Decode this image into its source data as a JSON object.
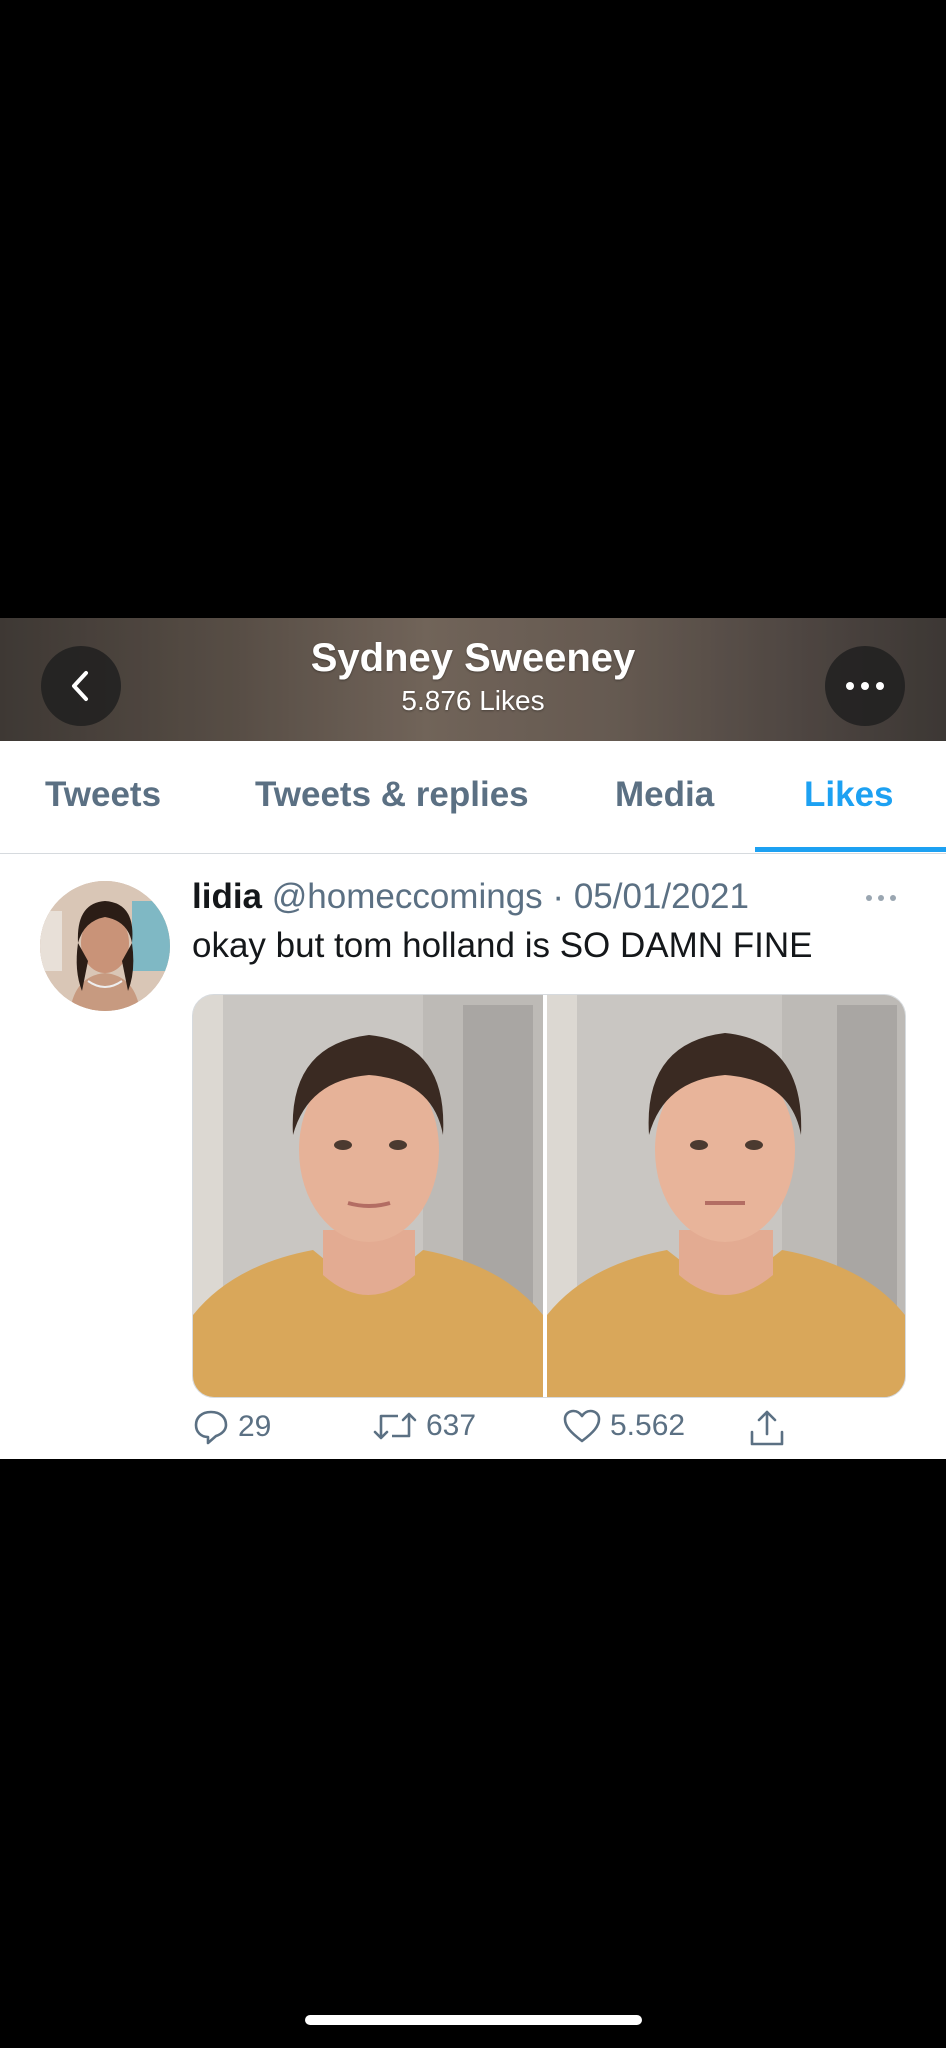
{
  "header": {
    "title": "Sydney Sweeney",
    "subtitle": "5.876 Likes",
    "back_icon": "chevron-left-icon",
    "more_icon": "more-horizontal-icon"
  },
  "tabs": [
    {
      "label": "Tweets",
      "active": false
    },
    {
      "label": "Tweets & replies",
      "active": false
    },
    {
      "label": "Media",
      "active": false
    },
    {
      "label": "Likes",
      "active": true
    }
  ],
  "tweet": {
    "name": "lidia",
    "handle": "@homeccomings",
    "separator": "·",
    "date": "05/01/2021",
    "text": "okay but tom holland is SO DAMN FINE",
    "actions": {
      "replies": "29",
      "retweets": "637",
      "likes": "5.562"
    }
  },
  "colors": {
    "accent": "#1da1f2",
    "secondary_text": "#5b7083",
    "primary_text": "#14171a"
  }
}
